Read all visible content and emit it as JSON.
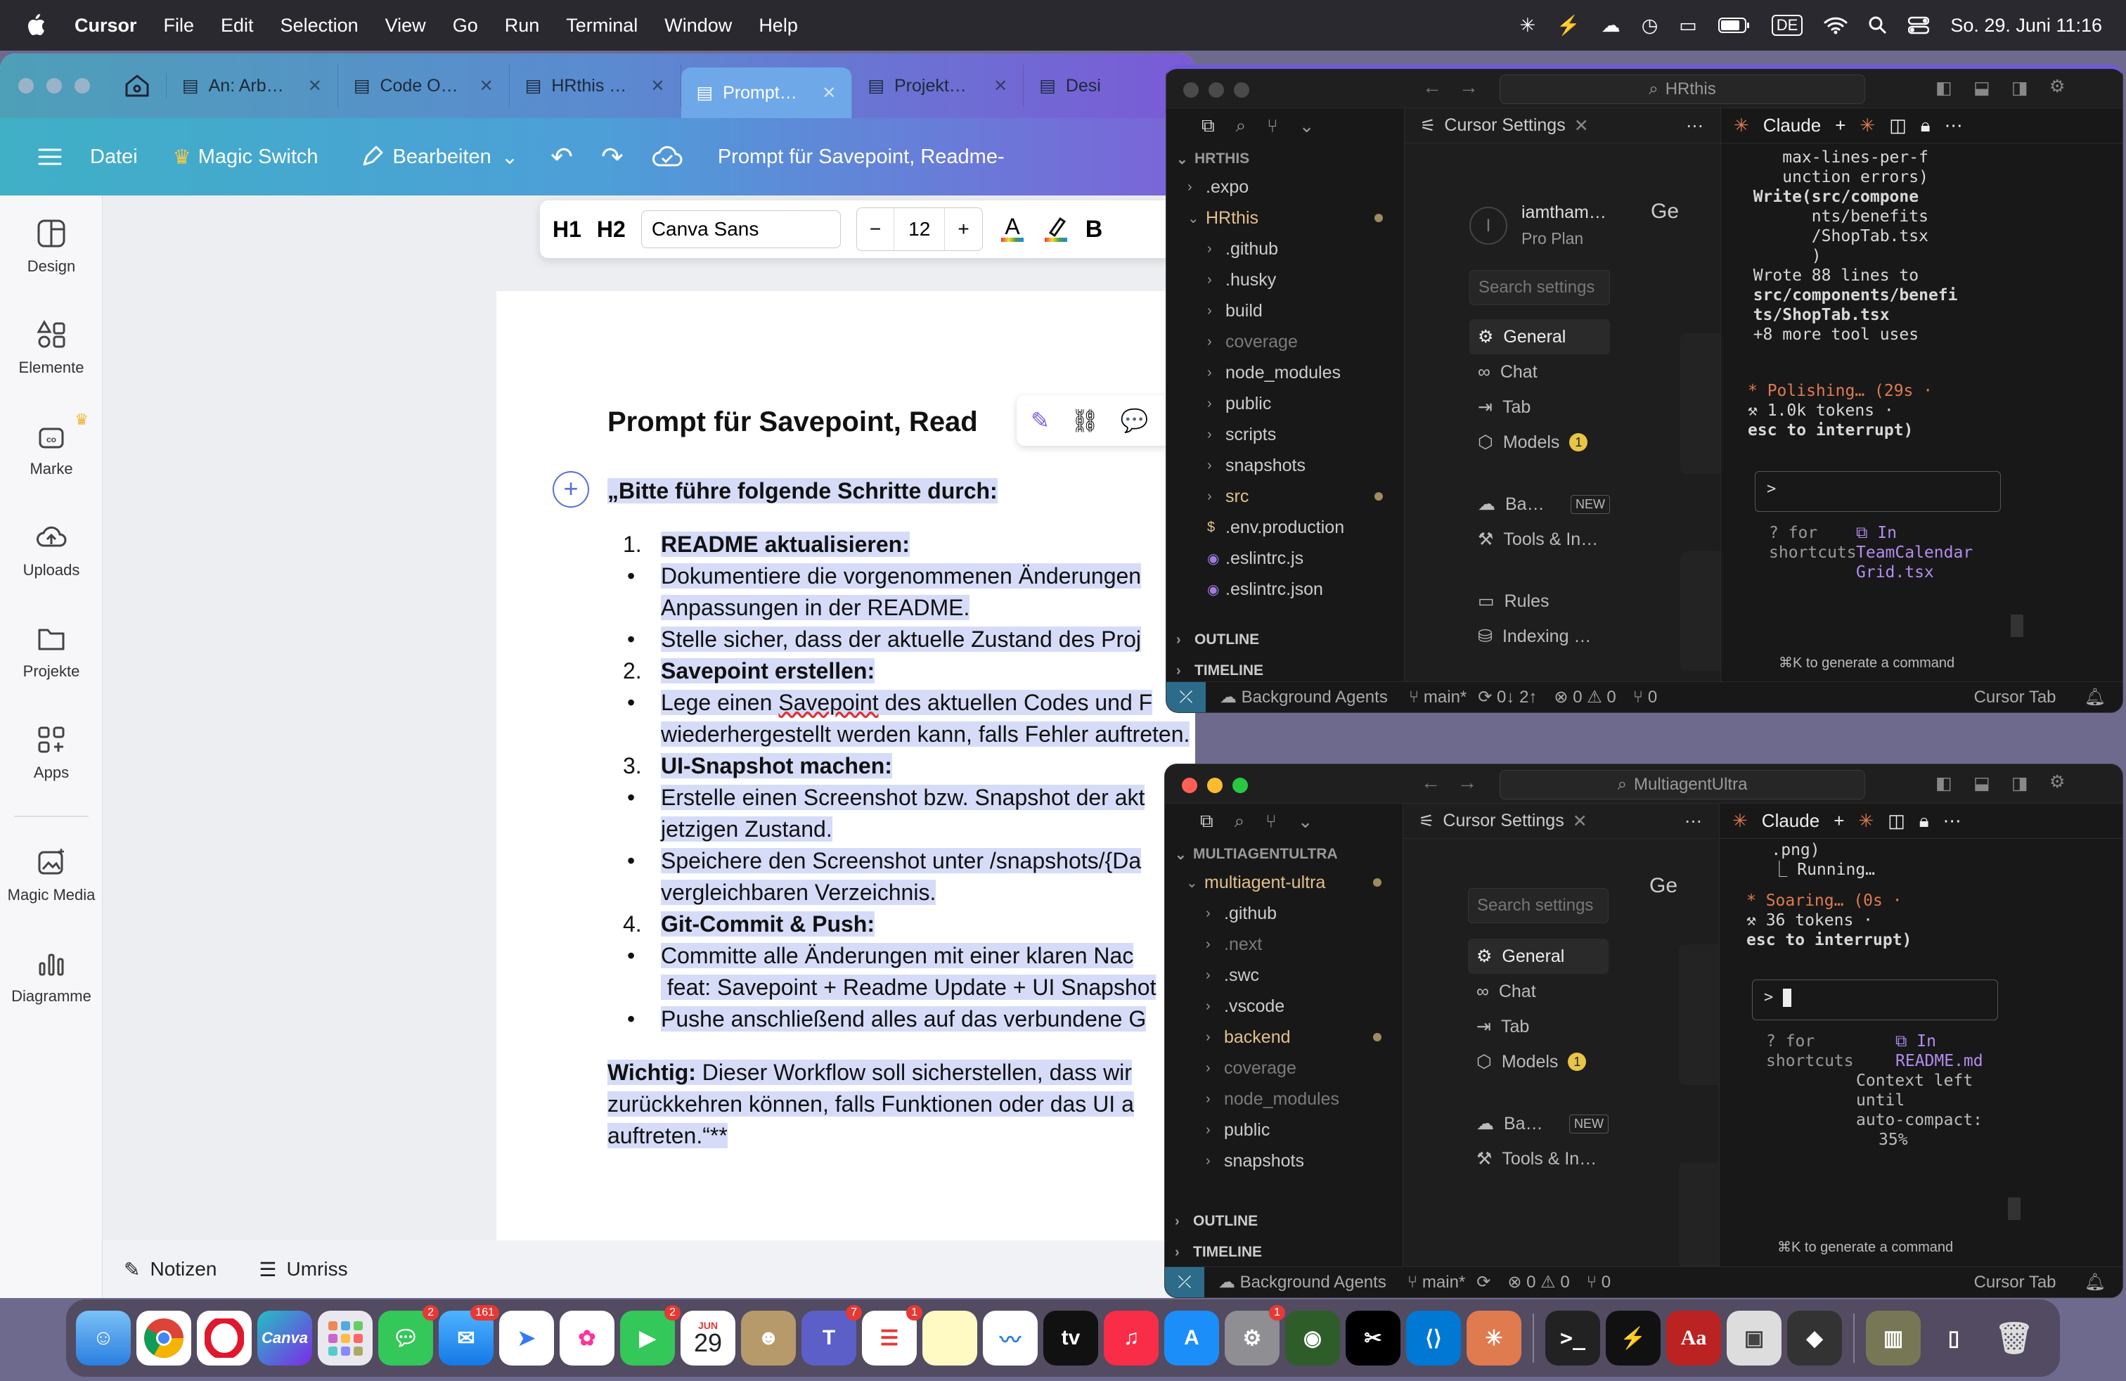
{
  "menubar": {
    "app": "Cursor",
    "items": [
      "File",
      "Edit",
      "Selection",
      "View",
      "Go",
      "Run",
      "Terminal",
      "Window",
      "Help"
    ],
    "keyboard": "DE",
    "datetime": "So. 29. Juni  11:16"
  },
  "canva": {
    "tabs": [
      {
        "label": "An: Arb…"
      },
      {
        "label": "Code O…"
      },
      {
        "label": "HRthis …"
      },
      {
        "label": "Prompt…"
      },
      {
        "label": "Projekt…"
      },
      {
        "label": "Desi"
      }
    ],
    "toolbar": {
      "file": "Datei",
      "magic": "Magic Switch",
      "edit": "Bearbeiten",
      "doc_title": "Prompt für Savepoint, Readme-"
    },
    "format": {
      "h1": "H1",
      "h2": "H2",
      "font": "Canva Sans",
      "size": "12",
      "minus": "−",
      "plus": "+",
      "bold": "B"
    },
    "sidebar": [
      {
        "label": "Design"
      },
      {
        "label": "Elemente"
      },
      {
        "label": "Marke"
      },
      {
        "label": "Uploads"
      },
      {
        "label": "Projekte"
      },
      {
        "label": "Apps"
      },
      {
        "label": "Magic Media"
      },
      {
        "label": "Diagramme"
      }
    ],
    "doc": {
      "heading": "Prompt für Savepoint, Read",
      "intro": "„Bitte führe folgende Schritte durch:",
      "s1_num": "1.",
      "s1": "README aktualisieren:",
      "s1_b1a": "Dokumentiere die vorgenommenen Änderungen",
      "s1_b1b": "Anpassungen in der README.",
      "s1_b2": "Stelle sicher, dass der aktuelle Zustand des Proj",
      "s2_num": "2.",
      "s2": "Savepoint erstellen:",
      "s2_b1a_pre": "Lege einen ",
      "s2_b1a_word": "Savepoint",
      "s2_b1a_post": " des aktuellen Codes und F",
      "s2_b1b": "wiederhergestellt werden kann, falls Fehler auftreten.",
      "s3_num": "3.",
      "s3": "UI-Snapshot machen:",
      "s3_b1a": "Erstelle einen Screenshot bzw. Snapshot der akt",
      "s3_b1b": "jetzigen Zustand.",
      "s3_b2a": "Speichere den Screenshot unter /snapshots/{Da",
      "s3_b2b": "vergleichbaren Verzeichnis.",
      "s4_num": "4.",
      "s4": "Git-Commit & Push:",
      "s4_b1a": "Committe alle Änderungen mit einer klaren Nac",
      "s4_b1b": " feat: Savepoint + Readme Update + UI Snapshot",
      "s4_b2": "Pushe anschließend alles auf das verbundene G",
      "note_label": "Wichtig:",
      "note_a": " Dieser Workflow soll sicherstellen, dass wir",
      "note_b": "zurückkehren können, falls Funktionen oder das UI a",
      "note_c": "auftreten.“**"
    },
    "bottom": {
      "notes": "Notizen",
      "outline": "Umriss"
    }
  },
  "cursor_top": {
    "search": "HRthis",
    "settings_tab": "Cursor Settings",
    "claude_tab": "Claude",
    "root": "HRTHIS",
    "tree": [
      {
        "name": ".expo",
        "color": "#cccccc",
        "depth": 1,
        "chev": "›"
      },
      {
        "name": "HRthis",
        "color": "#e2c08d",
        "depth": 1,
        "chev": "⌄",
        "dot": true
      },
      {
        "name": ".github",
        "color": "#cccccc",
        "depth": 2,
        "chev": "›"
      },
      {
        "name": ".husky",
        "color": "#cccccc",
        "depth": 2,
        "chev": "›"
      },
      {
        "name": "build",
        "color": "#cccccc",
        "depth": 2,
        "chev": "›"
      },
      {
        "name": "coverage",
        "color": "#7a7a7a",
        "depth": 2,
        "chev": "›"
      },
      {
        "name": "node_modules",
        "color": "#cccccc",
        "depth": 2,
        "chev": "›"
      },
      {
        "name": "public",
        "color": "#cccccc",
        "depth": 2,
        "chev": "›"
      },
      {
        "name": "scripts",
        "color": "#cccccc",
        "depth": 2,
        "chev": "›"
      },
      {
        "name": "snapshots",
        "color": "#cccccc",
        "depth": 2,
        "chev": "›"
      },
      {
        "name": "src",
        "color": "#e2c08d",
        "depth": 2,
        "chev": "›",
        "dot": true
      },
      {
        "name": ".env.production",
        "color": "#cccccc",
        "depth": 2,
        "chev": "$"
      },
      {
        "name": ".eslintrc.js",
        "color": "#cccccc",
        "depth": 2,
        "chev": "◉"
      },
      {
        "name": ".eslintrc.json",
        "color": "#cccccc",
        "depth": 2,
        "chev": "◉"
      }
    ],
    "outline": "OUTLINE",
    "timeline": "TIMELINE",
    "user": "iamtham…",
    "plan": "Pro Plan",
    "settings_search": "Search settings",
    "nav": [
      {
        "label": "General",
        "active": true
      },
      {
        "label": "Chat"
      },
      {
        "label": "Tab"
      },
      {
        "label": "Models",
        "badge": "1"
      },
      {
        "label": "Ba…",
        "tag": "NEW"
      },
      {
        "label": "Tools & In…"
      },
      {
        "label": "Rules"
      },
      {
        "label": "Indexing …"
      }
    ],
    "claude_lines": [
      "     max-lines-per-f",
      "     unction errors)",
      "  Write(src/compone",
      "        nts/benefits",
      "        /ShopTab.tsx",
      "        )",
      "  Wrote 88 lines to",
      "  src/components/benefi",
      "  ts/ShopTab.tsx",
      "  +8 more tool uses"
    ],
    "status_line1": "* Polishing… (29s ·",
    "status_line2": "⚒ 1.0k tokens ·",
    "status_line3": "esc to interrupt)",
    "prompt": ">",
    "hint_a": "? for",
    "hint_b": "shortcuts",
    "file_a": "⧉ In",
    "file_b": "TeamCalendar",
    "file_c": "Grid.tsx",
    "cmd_hint": "⌘K to generate a command",
    "status": {
      "agents": "Background Agents",
      "branch": "main*",
      "sync": "0↓ 2↑",
      "problems": "⊗ 0 ⚠ 0",
      "ports": "⑂ 0",
      "right": "Cursor Tab"
    }
  },
  "cursor_bottom": {
    "search": "MultiagentUltra",
    "settings_tab": "Cursor Settings",
    "claude_tab": "Claude",
    "root": "MULTIAGENTULTRA",
    "tree": [
      {
        "name": "multiagent-ultra",
        "color": "#e2c08d",
        "depth": 1,
        "chev": "⌄",
        "dot": true
      },
      {
        "name": ".github",
        "color": "#cccccc",
        "depth": 2,
        "chev": "›"
      },
      {
        "name": ".next",
        "color": "#7a7a7a",
        "depth": 2,
        "chev": "›"
      },
      {
        "name": ".swc",
        "color": "#cccccc",
        "depth": 2,
        "chev": "›"
      },
      {
        "name": ".vscode",
        "color": "#cccccc",
        "depth": 2,
        "chev": "›"
      },
      {
        "name": "backend",
        "color": "#e2c08d",
        "depth": 2,
        "chev": "›",
        "dot": true
      },
      {
        "name": "coverage",
        "color": "#7a7a7a",
        "depth": 2,
        "chev": "›"
      },
      {
        "name": "node_modules",
        "color": "#7a7a7a",
        "depth": 2,
        "chev": "›"
      },
      {
        "name": "public",
        "color": "#cccccc",
        "depth": 2,
        "chev": "›"
      },
      {
        "name": "snapshots",
        "color": "#cccccc",
        "depth": 2,
        "chev": "›"
      }
    ],
    "outline": "OUTLINE",
    "timeline": "TIMELINE",
    "settings_search": "Search settings",
    "nav": [
      {
        "label": "General",
        "active": true
      },
      {
        "label": "Chat"
      },
      {
        "label": "Tab"
      },
      {
        "label": "Models",
        "badge": "1"
      },
      {
        "label": "Ba…",
        "tag": "NEW"
      },
      {
        "label": "Tools & In…"
      }
    ],
    "claude_lines": [
      "    .png)",
      "    ⎿ Running…"
    ],
    "status_line1": "* Soaring… (0s ·",
    "status_line2": "⚒ 36 tokens ·",
    "status_line3": "esc to interrupt)",
    "prompt": ">",
    "hint_a": "? for",
    "hint_b": "shortcuts",
    "file_a": "⧉ In",
    "file_b": "README.md",
    "ctx_a": "Context left",
    "ctx_b": "until",
    "ctx_c": "auto-compact:",
    "ctx_d": "35%",
    "cmd_hint": "⌘K to generate a command",
    "status": {
      "agents": "Background Agents",
      "branch": "main*",
      "problems": "⊗ 0 ⚠ 0",
      "ports": "⑂ 0",
      "right": "Cursor Tab"
    }
  },
  "dock": {
    "calendar_month": "JUN",
    "calendar_day": "29",
    "badges": {
      "messages": "2",
      "mail": "161",
      "facetime": "2",
      "teams": "7",
      "reminders": "1",
      "settings": "1"
    }
  }
}
